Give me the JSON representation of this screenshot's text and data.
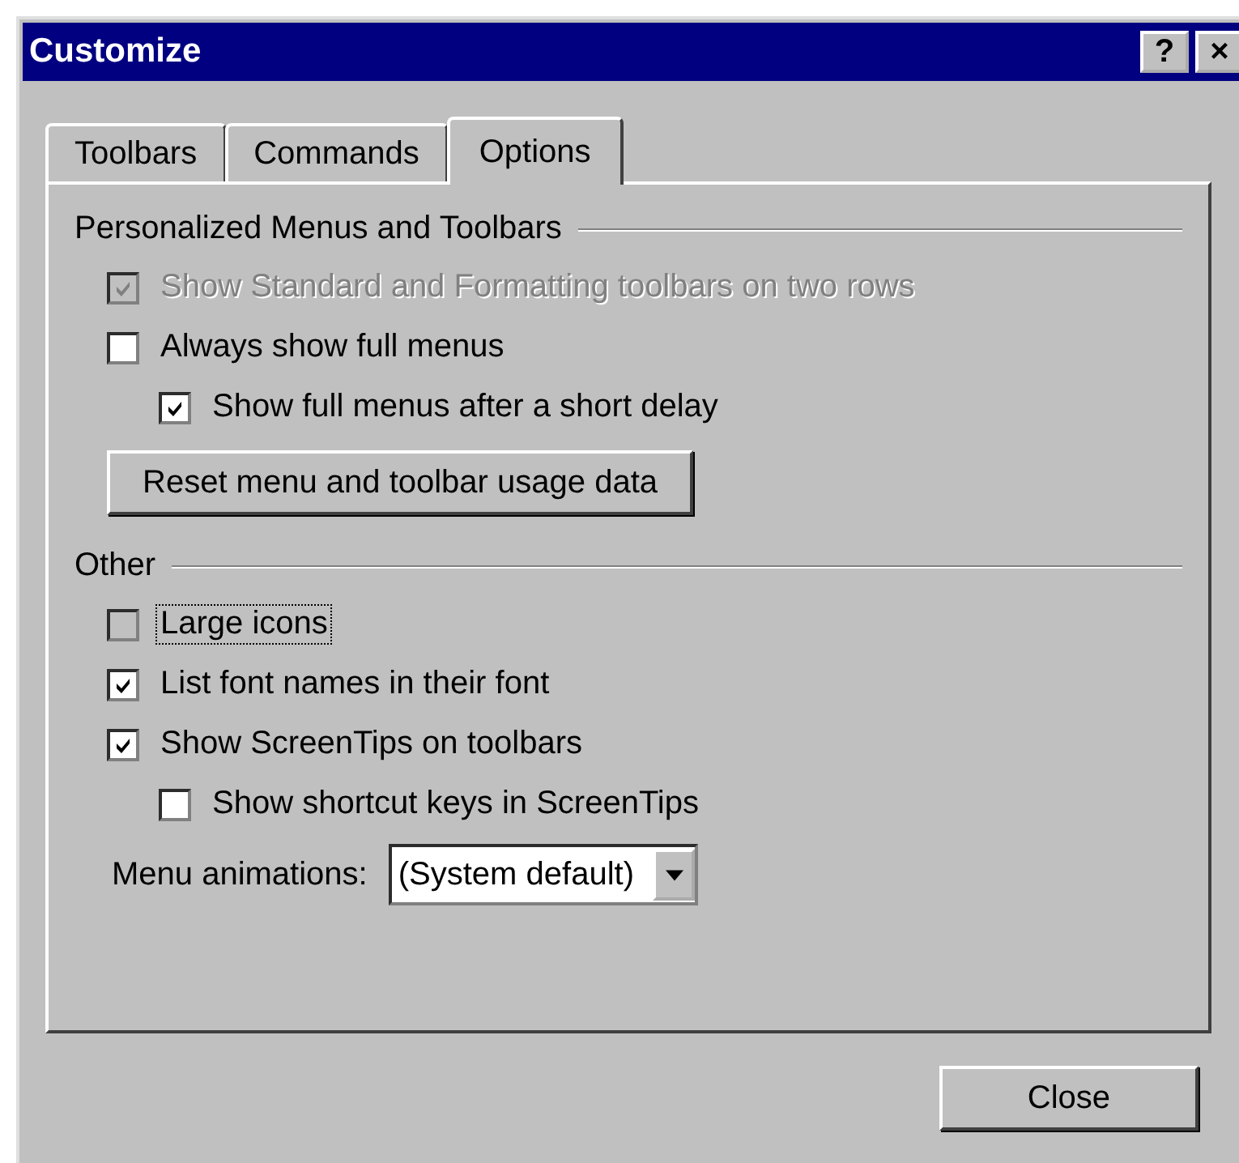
{
  "window": {
    "title": "Customize",
    "help_button": "?",
    "close_button": "×"
  },
  "tabs": [
    {
      "label": "Toolbars",
      "selected": false
    },
    {
      "label": "Commands",
      "selected": false
    },
    {
      "label": "Options",
      "selected": true
    }
  ],
  "groups": [
    {
      "title": "Personalized Menus and Toolbars",
      "items": [
        {
          "kind": "checkbox",
          "label": "Show Standard and Formatting toolbars on two rows",
          "checked": true,
          "disabled": true,
          "indented": false,
          "focused": false
        },
        {
          "kind": "checkbox",
          "label": "Always show full menus",
          "checked": false,
          "disabled": false,
          "indented": false,
          "focused": false
        },
        {
          "kind": "checkbox",
          "label": "Show full menus after a short delay",
          "checked": true,
          "disabled": false,
          "indented": true,
          "focused": false
        },
        {
          "kind": "button",
          "label": "Reset menu and toolbar usage data"
        }
      ]
    },
    {
      "title": "Other",
      "items": [
        {
          "kind": "checkbox",
          "label": "Large icons",
          "checked": false,
          "disabled": false,
          "indented": false,
          "focused": true
        },
        {
          "kind": "checkbox",
          "label": "List font names in their font",
          "checked": true,
          "disabled": false,
          "indented": false,
          "focused": false
        },
        {
          "kind": "checkbox",
          "label": "Show ScreenTips on toolbars",
          "checked": true,
          "disabled": false,
          "indented": false,
          "focused": false
        },
        {
          "kind": "checkbox",
          "label": "Show shortcut keys in ScreenTips",
          "checked": false,
          "disabled": false,
          "indented": true,
          "focused": false
        },
        {
          "kind": "dropdown",
          "label": "Menu animations:",
          "value": "(System default)"
        }
      ]
    }
  ],
  "buttons": [
    {
      "label": "Close"
    }
  ]
}
